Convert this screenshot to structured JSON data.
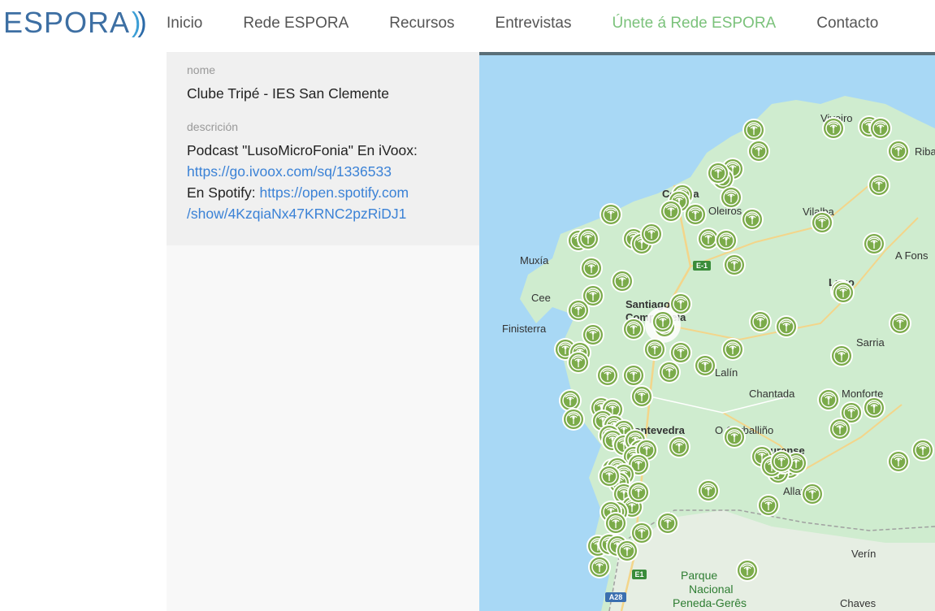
{
  "header": {
    "logo_text": "ESPORA",
    "nav": [
      "Inicio",
      "Rede ESPORA",
      "Recursos",
      "Entrevistas",
      "Únete á Rede ESPORA",
      "Contacto"
    ],
    "active_nav_index": 4
  },
  "detail": {
    "nome_label": "nome",
    "nome_value": "Clube Tripé - IES San Clemente",
    "descricion_label": "descrición",
    "desc_line1": "Podcast \"LusoMicroFonia\" En iVoox:",
    "link1": "https://go.ivoox.com/sq/1336533",
    "spotify_prefix": "En Spotify: ",
    "link2a": "https://open.spotify.com",
    "link2b": "/show/4KzqiaNx47KRNC2pzRiDJ1"
  },
  "map": {
    "places": [
      "Muxía",
      "Cee",
      "Finisterra",
      "Santiago de Compostela",
      "Lalín",
      "Chantada",
      "Sarria",
      "Monforte",
      "O Carballiño",
      "Ourense",
      "Allariz",
      "Verín",
      "Chaves",
      "Vilalba",
      "A Fonsagrada",
      "Lugo",
      "Oleiros",
      "Coruña",
      "Viveiro",
      "Ribadeo",
      "Pontevedra",
      "Parque Nacional Peneda-Gerês",
      "E-1",
      "A28"
    ],
    "colors": {
      "water": "#a8d8f5",
      "land": "#cfeccf",
      "marker": "#7bab4a"
    }
  }
}
